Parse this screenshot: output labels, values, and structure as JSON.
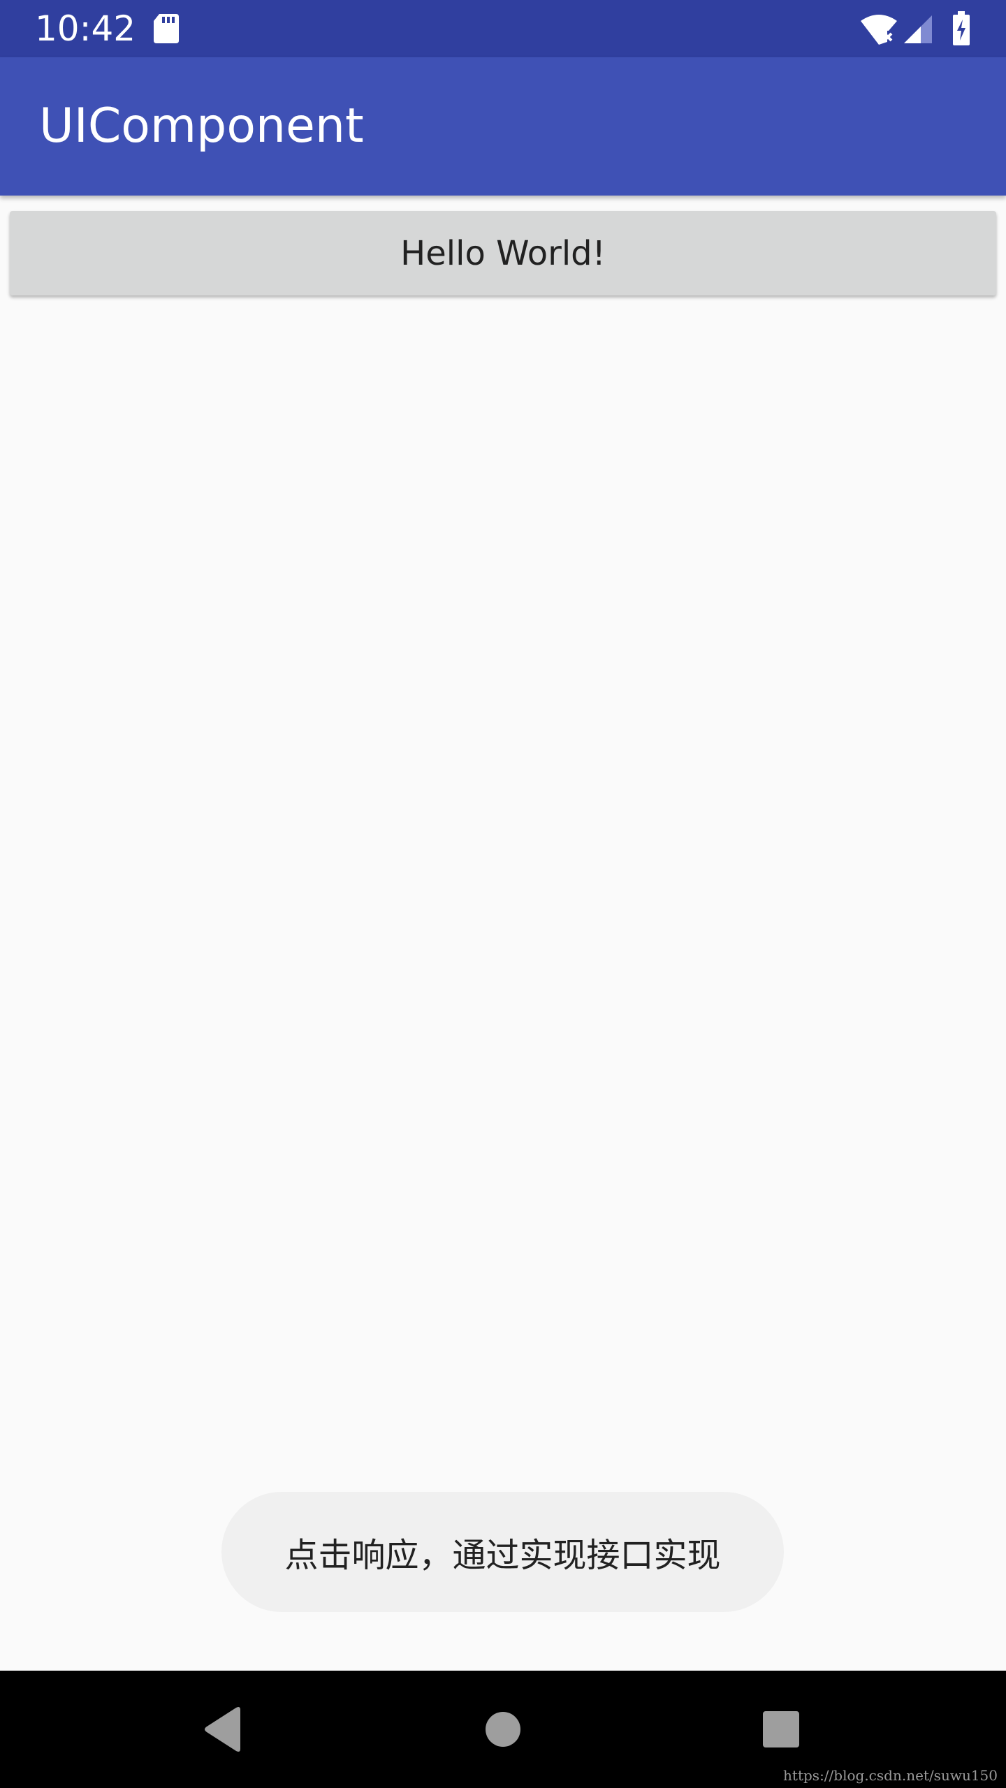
{
  "status_bar": {
    "time": "10:42",
    "icons": [
      "sd-card-icon",
      "wifi-no-internet-icon",
      "cellular-signal-icon",
      "battery-charging-icon"
    ],
    "background_color": "#303f9f"
  },
  "app_bar": {
    "title": "UIComponent",
    "background_color": "#3f51b5"
  },
  "main": {
    "button_label": "Hello World!"
  },
  "toast": {
    "message": "点击响应，通过实现接口实现"
  },
  "nav_bar": {
    "buttons": [
      "back-icon",
      "home-icon",
      "recents-icon"
    ]
  },
  "watermark": "https://blog.csdn.net/suwu150"
}
